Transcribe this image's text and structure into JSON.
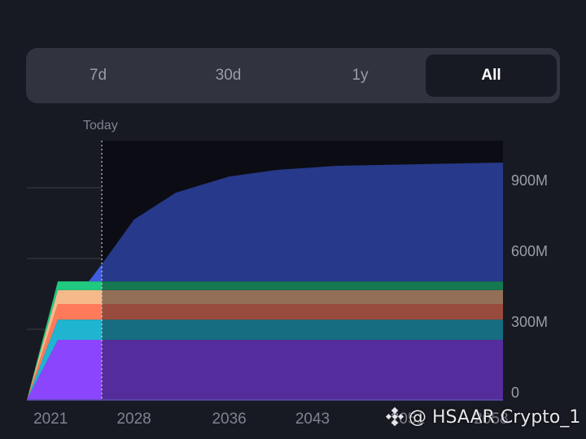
{
  "tabs": [
    {
      "label": "7d",
      "active": false
    },
    {
      "label": "30d",
      "active": false
    },
    {
      "label": "1y",
      "active": false
    },
    {
      "label": "All",
      "active": true
    }
  ],
  "today_label": "Today",
  "watermark": "@ HSAAR Crypto_1",
  "chart_data": {
    "type": "area",
    "stacked": true,
    "x": [
      2019,
      2021.6,
      2024.2,
      2025.3,
      2028,
      2031.5,
      2036,
      2040,
      2045,
      2059
    ],
    "series": [
      {
        "color": "#8b45fd",
        "values": [
          0,
          255,
          255,
          255,
          255,
          255,
          255,
          255,
          255,
          255
        ]
      },
      {
        "color": "#1fb5d0",
        "values": [
          0,
          86,
          86,
          86,
          86,
          86,
          86,
          86,
          86,
          86
        ]
      },
      {
        "color": "#ff7a5a",
        "values": [
          0,
          66,
          66,
          66,
          66,
          66,
          66,
          66,
          66,
          66
        ]
      },
      {
        "color": "#f6b98a",
        "values": [
          0,
          59,
          59,
          59,
          59,
          59,
          59,
          59,
          59,
          59
        ]
      },
      {
        "color": "#1fc97f",
        "values": [
          0,
          37,
          37,
          37,
          37,
          37,
          37,
          37,
          37,
          37
        ]
      },
      {
        "color": "#3d5ce0",
        "values": [
          0,
          0,
          0,
          73,
          262,
          376,
          445,
          473,
          490,
          504
        ]
      }
    ],
    "today_x": 2025.3,
    "xlim": [
      2019,
      2059
    ],
    "ylim": [
      0,
      1100
    ],
    "x_ticks": [
      {
        "value": 2021,
        "label": "2021"
      },
      {
        "value": 2028,
        "label": "2028"
      },
      {
        "value": 2036,
        "label": "2036"
      },
      {
        "value": 2043,
        "label": "2043"
      },
      {
        "value": 2051,
        "label": "2051"
      },
      {
        "value": 2058,
        "label": "2058"
      }
    ],
    "y_ticks": [
      {
        "value": 0,
        "label": "0"
      },
      {
        "value": 300,
        "label": "300M"
      },
      {
        "value": 600,
        "label": "600M"
      },
      {
        "value": 900,
        "label": "900M"
      }
    ],
    "y_axis_position": "right",
    "grid": true,
    "colors": {
      "background": "#181a23",
      "future_background": "#0f1016",
      "tick_text": "#9a9ca6"
    }
  }
}
